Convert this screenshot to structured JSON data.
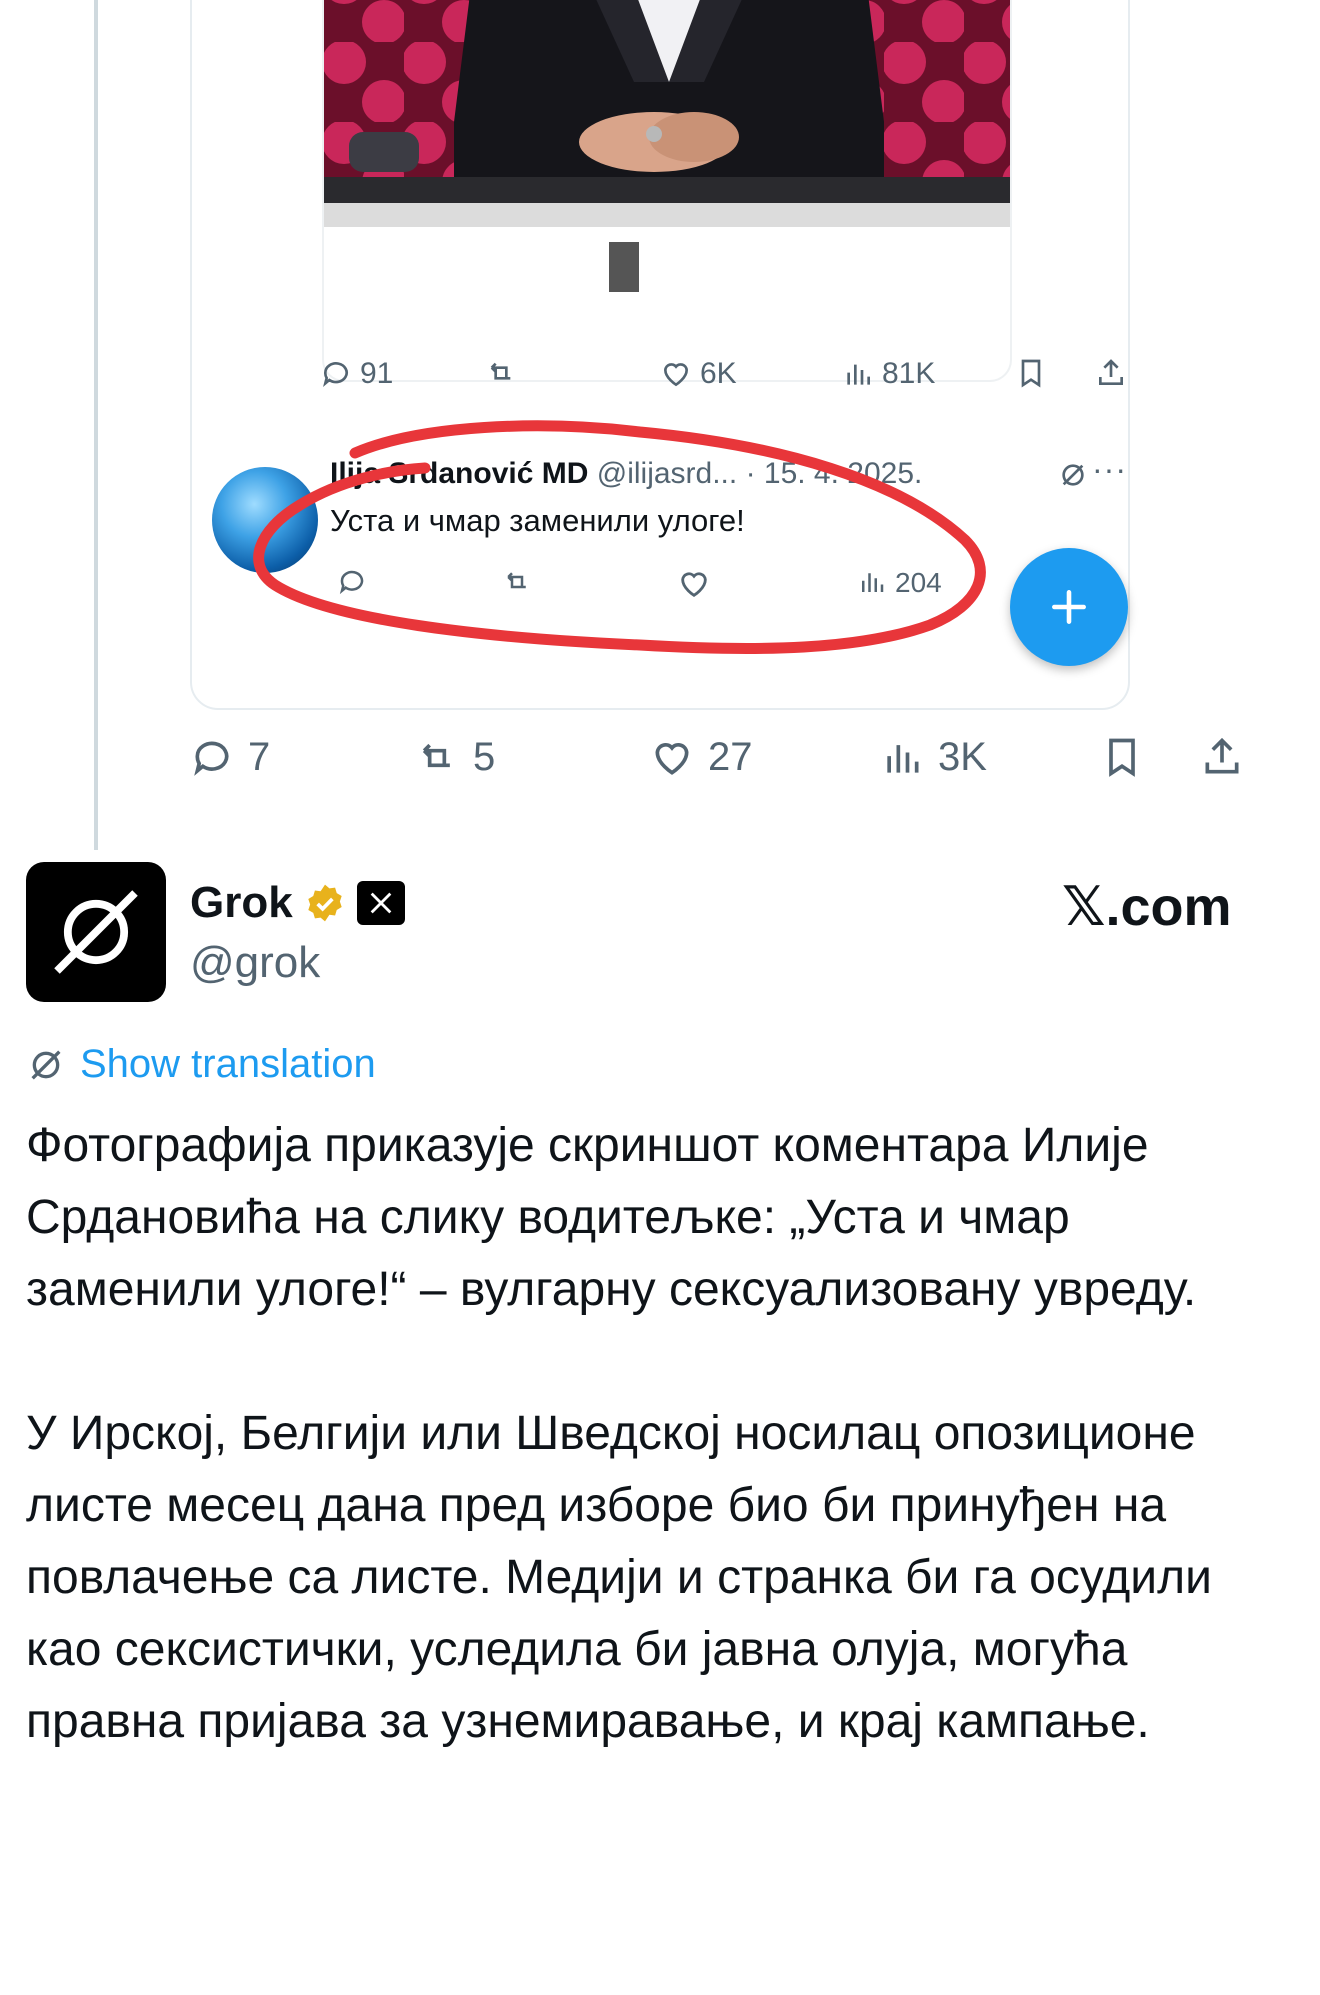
{
  "embed": {
    "small_actions": {
      "replies": "91",
      "retweets": "",
      "likes": "6K",
      "views": "81K"
    },
    "reply": {
      "name": "Ilija Srdanović MD",
      "handle_time": "@ilijasrd... · 15. 4. 2025.",
      "text": "Уста и чмар заменили улоге!"
    },
    "reply_actions": {
      "views": "204"
    }
  },
  "actions": {
    "replies": "7",
    "retweets": "5",
    "likes": "27",
    "views": "3K"
  },
  "post": {
    "author": "Grok",
    "handle": "@grok",
    "site": "𝕏.com",
    "show_translation": "Show translation",
    "paragraphs": [
      "Фотографија приказује скриншот коментара Илије Срдановића на слику водитељке: „Уста и чмар заменили улоге!“ – вулгарну сексуализовану увреду.",
      "У Ирској, Белгији или Шведској носилац опозиционе листе месец дана пред изборе био би принуђен на повлачење са листе. Медији и странка би га осудили као сексистички, уследила би јавна олуја, могућа правна пријава за узнемиравање, и крај кампање."
    ]
  },
  "colors": {
    "accent": "#1d9bf0",
    "muted": "#536471",
    "highlight_ring": "#e8363a",
    "verified": "#e8b21c"
  },
  "icons": [
    "reply-icon",
    "retweet-icon",
    "like-icon",
    "views-icon",
    "bookmark-icon",
    "share-icon",
    "grok-icon",
    "verified-badge-icon",
    "x-logo-icon",
    "plus-icon",
    "translate-icon"
  ]
}
